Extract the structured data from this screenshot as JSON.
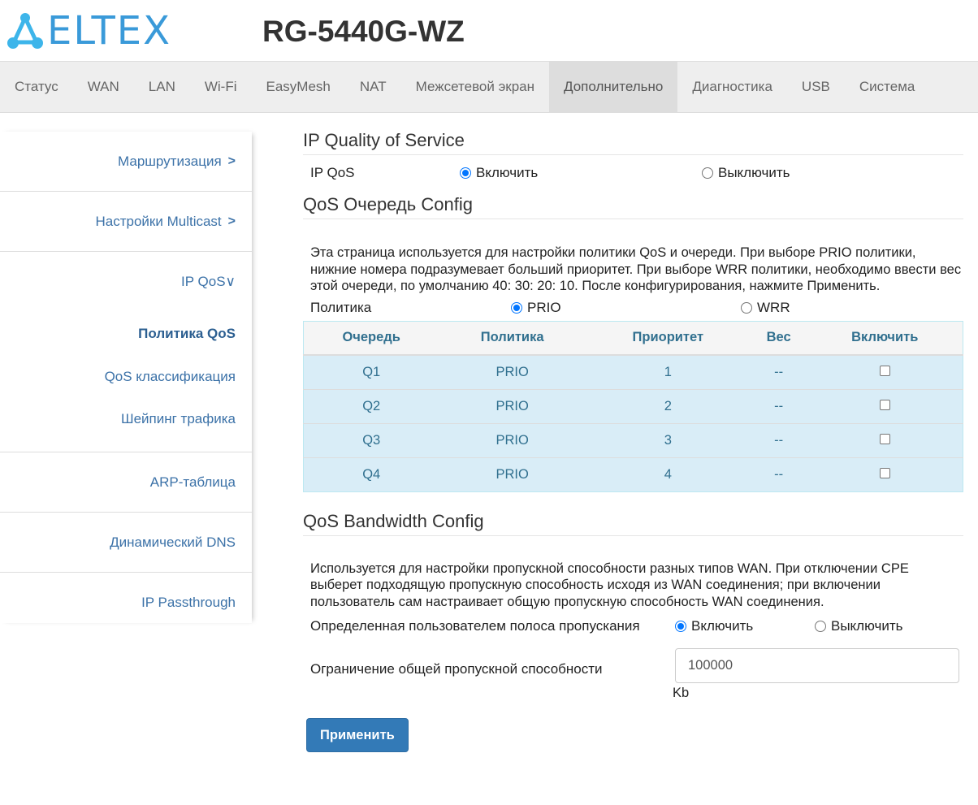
{
  "header": {
    "logo_text": "ELTEX",
    "model": "RG-5440G-WZ"
  },
  "nav": [
    "Статус",
    "WAN",
    "LAN",
    "Wi-Fi",
    "EasyMesh",
    "NAT",
    "Межсетевой экран",
    "Дополнительно",
    "Диагностика",
    "USB",
    "Система"
  ],
  "nav_active": "Дополнительно",
  "sidebar": {
    "routing": "Маршрутизация",
    "multicast": "Настройки Multicast",
    "ipqos": "IP QoS",
    "qos_policy": "Политика QoS",
    "qos_class": "QoS классификация",
    "shaping": "Шейпинг трафика",
    "arp": "ARP-таблица",
    "ddns": "Динамический DNS",
    "passthrough": "IP Passthrough"
  },
  "ipqos": {
    "title": "IP Quality of Service",
    "label": "IP QoS",
    "on": "Включить",
    "off": "Выключить",
    "value": "on"
  },
  "queue": {
    "title": "QoS Очередь Config",
    "desc": "Эта страница используется для настройки политики QoS и очереди. При выборе PRIO политики, нижние номера подразумевает больший приоритет. При выборе WRR политики, необходимо ввести вес этой очереди, по умолчанию 40: 30: 20: 10. После конфигурирования, нажмите Применить.",
    "policy_label": "Политика",
    "prio": "PRIO",
    "wrr": "WRR",
    "value": "PRIO",
    "columns": [
      "Очередь",
      "Политика",
      "Приоритет",
      "Вес",
      "Включить"
    ],
    "rows": [
      {
        "q": "Q1",
        "p": "PRIO",
        "pr": "1",
        "w": "--"
      },
      {
        "q": "Q2",
        "p": "PRIO",
        "pr": "2",
        "w": "--"
      },
      {
        "q": "Q3",
        "p": "PRIO",
        "pr": "3",
        "w": "--"
      },
      {
        "q": "Q4",
        "p": "PRIO",
        "pr": "4",
        "w": "--"
      }
    ]
  },
  "bw": {
    "title": "QoS Bandwidth Config",
    "desc": "Используется для настройки пропускной способности разных типов WAN. При отключении CPE выберет подходящую пропускную способность исходя из WAN соединения; при включении пользователь сам настраивает общую пропускную способность WAN соединения.",
    "user_label": "Определенная пользователем полоса пропускания",
    "on": "Включить",
    "off": "Выключить",
    "limit_label": "Ограничение общей пропускной способности",
    "limit_value": "100000",
    "unit": "Kb"
  },
  "apply": "Применить"
}
